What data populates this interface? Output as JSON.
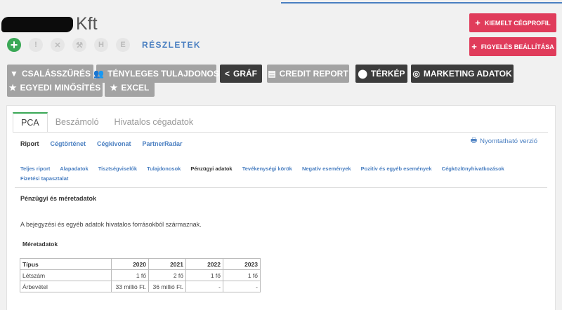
{
  "header": {
    "company_suffix": "Kft",
    "details_link": "RÉSZLETEK",
    "icons": [
      {
        "name": "plus-icon",
        "glyph": "+"
      },
      {
        "name": "exclamation-icon",
        "glyph": "!"
      },
      {
        "name": "x-icon",
        "glyph": "✕"
      },
      {
        "name": "hammer-icon",
        "glyph": "⚒"
      },
      {
        "name": "h-icon",
        "glyph": "H"
      },
      {
        "name": "e-icon",
        "glyph": "E"
      }
    ]
  },
  "actions": {
    "highlight_profile": "KIEMELT CÉGPROFIL",
    "watch_settings": "FIGYELÉS BEÁLLÍTÁSA"
  },
  "filters": {
    "family_filter": "CSALÁSSZŰRÉS",
    "beneficial_owner": "TÉNYLEGES TULAJDONOS",
    "graph": "GRÁF",
    "credit_report": "CREDIT REPORT",
    "map": "TÉRKÉP",
    "marketing": "MARKETING ADATOK",
    "custom_rating": "EGYEDI MINŐSÍTÉS",
    "excel": "EXCEL"
  },
  "tabs": [
    "PCA",
    "Beszámoló",
    "Hivatalos cégadatok"
  ],
  "subnav": [
    "Riport",
    "Cégtörténet",
    "Cégkivonat",
    "PartnerRadar"
  ],
  "print_link": "Nyomtatható verzió",
  "sections": [
    "Teljes riport",
    "Alapadatok",
    "Tisztségviselők",
    "Tulajdonosok",
    "Pénzügyi adatok",
    "Tevékenységi körök",
    "Negatív események",
    "Pozitív és egyéb események",
    "Cégközlönyhivatkozások",
    "Fizetési tapasztalat"
  ],
  "content": {
    "section_title": "Pénzügyi és méretadatok",
    "intro": "A bejegyzési és egyéb adatok hivatalos forrásokból származnak.",
    "size_title": "Méretadatok"
  },
  "table": {
    "headers": [
      "Típus",
      "2020",
      "2021",
      "2022",
      "2023"
    ],
    "rows": [
      [
        "Létszám",
        "1 fő",
        "2 fő",
        "1 fő",
        "1 fő"
      ],
      [
        "Árbevétel",
        "33 millió Ft.",
        "36 millió Ft.",
        "-",
        "-"
      ]
    ]
  },
  "colors": {
    "accent_blue": "#4a7fc1",
    "red": "#e03c5b",
    "green": "#3aa856",
    "dark": "#3c3c3c",
    "grey": "#a3a3a3"
  }
}
